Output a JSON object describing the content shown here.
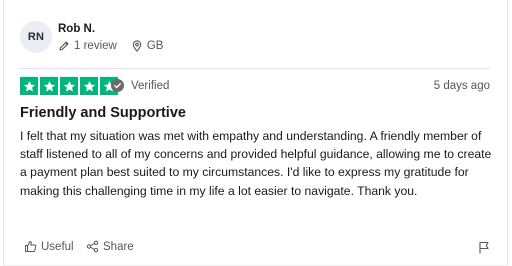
{
  "reviewer": {
    "initials": "RN",
    "name": "Rob N.",
    "review_count": "1 review",
    "country": "GB"
  },
  "rating": {
    "stars": 5,
    "max_stars": 5,
    "verified_label": "Verified",
    "date": "5 days ago",
    "star_color": "#00b67a"
  },
  "review": {
    "title": "Friendly and Supportive",
    "body": "I felt that my situation was met with empathy and understanding. A friendly member of staff listened to all of my concerns and provided helpful guidance, allowing me to create a payment plan best suited to my circumstances. I'd like to express my gratitude for making this challenging time in my life a lot easier to navigate. Thank you."
  },
  "actions": {
    "useful_label": "Useful",
    "share_label": "Share"
  },
  "icons": [
    "pencil-icon",
    "location-pin-icon",
    "star-icon",
    "verified-check-icon",
    "thumbs-up-icon",
    "share-icon",
    "flag-icon"
  ]
}
